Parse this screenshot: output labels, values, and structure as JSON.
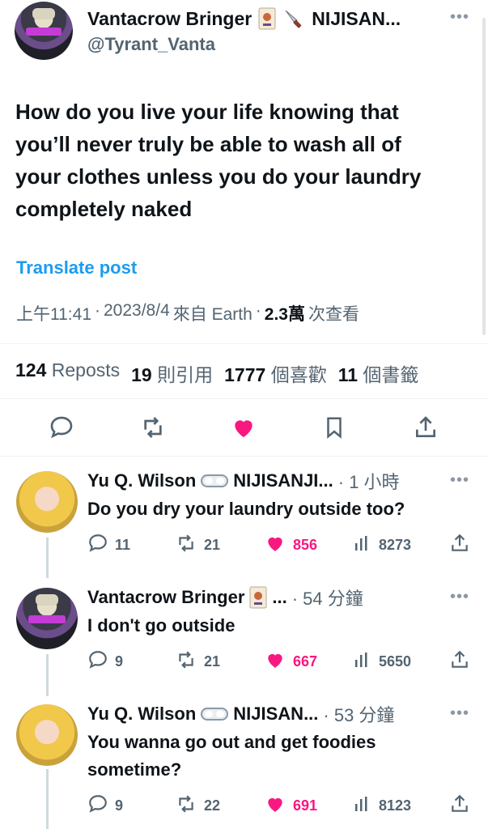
{
  "post": {
    "author_name": "Vantacrow Bringer",
    "author_suffix": "NIJISAN...",
    "author_handle": "@Tyrant_Vanta",
    "text_lines": [
      "How do you live your life knowing that",
      "you’ll never truly be able to wash all of",
      "your clothes unless you do your laundry",
      "completely naked"
    ],
    "translate_label": "Translate post",
    "meta_time": "上午11:41",
    "meta_date": "2023/8/4",
    "meta_source": "來自 Earth",
    "meta_views_count": "2.3萬",
    "meta_views_label": "次查看",
    "stats": {
      "reposts_count": "124",
      "reposts_label": "Reposts",
      "quotes_count": "19",
      "quotes_label": "則引用",
      "likes_count": "1777",
      "likes_label": "個喜歡",
      "bookmarks_count": "11",
      "bookmarks_label": "個書籤"
    }
  },
  "replies": [
    {
      "name": "Yu Q. Wilson",
      "suffix": "NIJISANJI...",
      "time": "· 1 小時",
      "text": "Do you dry your laundry outside too?",
      "replies": "11",
      "reposts": "21",
      "likes": "856",
      "views": "8273"
    },
    {
      "name": "Vantacrow Bringer",
      "suffix": "...",
      "time": "· 54 分鐘",
      "text": "I don't go outside",
      "replies": "9",
      "reposts": "21",
      "likes": "667",
      "views": "5650"
    },
    {
      "name": "Yu Q. Wilson",
      "suffix": "NIJISAN...",
      "time": "· 53 分鐘",
      "text_lines": [
        "You wanna go out and get foodies",
        "sometime?"
      ],
      "replies": "9",
      "reposts": "22",
      "likes": "691",
      "views": "8123"
    }
  ],
  "colors": {
    "link": "#1d9bf0",
    "like": "#f91880",
    "muted": "#536471",
    "text": "#0f1419"
  },
  "icons": [
    "more-icon",
    "reply-icon",
    "repost-icon",
    "like-icon",
    "bookmark-icon",
    "share-icon",
    "views-icon",
    "goggles-emoji-icon",
    "joker-card-emoji-icon",
    "knife-emoji-icon"
  ]
}
